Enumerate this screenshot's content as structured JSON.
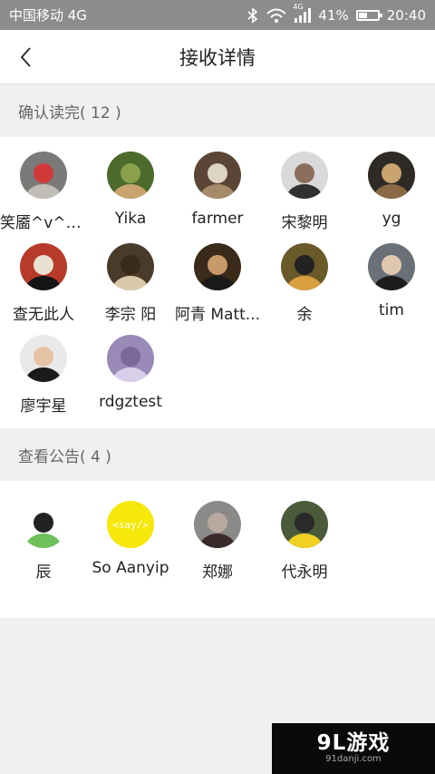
{
  "status_bar": {
    "carrier": "中国移动 4G",
    "network_badge": "4G",
    "battery_percent": "41%",
    "battery_level": 0.41,
    "time": "20:40",
    "icons": [
      "bluetooth-icon",
      "wifi-icon",
      "signal-icon",
      "battery-icon"
    ]
  },
  "nav": {
    "title": "接收详情",
    "back_icon": "chevron-left-icon"
  },
  "sections": [
    {
      "label": "确认读完( 12 )",
      "people": [
        {
          "name": "笑靥^v^小...",
          "colors": [
            "#7a7a78",
            "#c0bdb6",
            "#d23a3a"
          ]
        },
        {
          "name": "Yika",
          "colors": [
            "#4b6a2c",
            "#c9a46e",
            "#8aa04a"
          ]
        },
        {
          "name": "farmer",
          "colors": [
            "#5b4636",
            "#a78a6a",
            "#ddd4c4"
          ]
        },
        {
          "name": "宋黎明",
          "colors": [
            "#d9d9d9",
            "#303030",
            "#8a6e5c"
          ]
        },
        {
          "name": "yg",
          "colors": [
            "#2e2a26",
            "#8a6a45",
            "#c9a46e"
          ]
        },
        {
          "name": "查无此人",
          "colors": [
            "#b83a2a",
            "#151515",
            "#e8e0d0"
          ]
        },
        {
          "name": "李宗 阳",
          "colors": [
            "#4a3a2a",
            "#d9c9a8",
            "#3a2a1a"
          ]
        },
        {
          "name": "阿青 Matt...",
          "colors": [
            "#3a2a1a",
            "#1a1a1a",
            "#c89a6a"
          ]
        },
        {
          "name": "余",
          "colors": [
            "#6a5a2a",
            "#d9a040",
            "#222222"
          ]
        },
        {
          "name": "tim",
          "colors": [
            "#6a7078",
            "#1d1d1d",
            "#e0c8b0"
          ]
        },
        {
          "name": "廖宇星",
          "colors": [
            "#e9e9e9",
            "#1a1a1a",
            "#e5c3a5"
          ]
        },
        {
          "name": "rdgztest",
          "colors": [
            "#9a8ab8",
            "#d8d0e8",
            "#7a6a9a"
          ]
        }
      ]
    },
    {
      "label": "查看公告( 4 )",
      "people": [
        {
          "name": "辰",
          "colors": [
            "#ffffff",
            "#6ec05a",
            "#222222"
          ]
        },
        {
          "name": "So Aanyip",
          "colors": [
            "#f5e80a",
            "#f5e80a",
            "#ffffff"
          ],
          "avatar_text": "<say/>"
        },
        {
          "name": "郑娜",
          "colors": [
            "#8a8a88",
            "#3a2a2a",
            "#b8a8a0"
          ]
        },
        {
          "name": "代永明",
          "colors": [
            "#4a5a3a",
            "#f0d020",
            "#2a2a2a"
          ]
        }
      ]
    }
  ],
  "watermark": {
    "main": "9L游戏",
    "sub": "91danji.com"
  }
}
